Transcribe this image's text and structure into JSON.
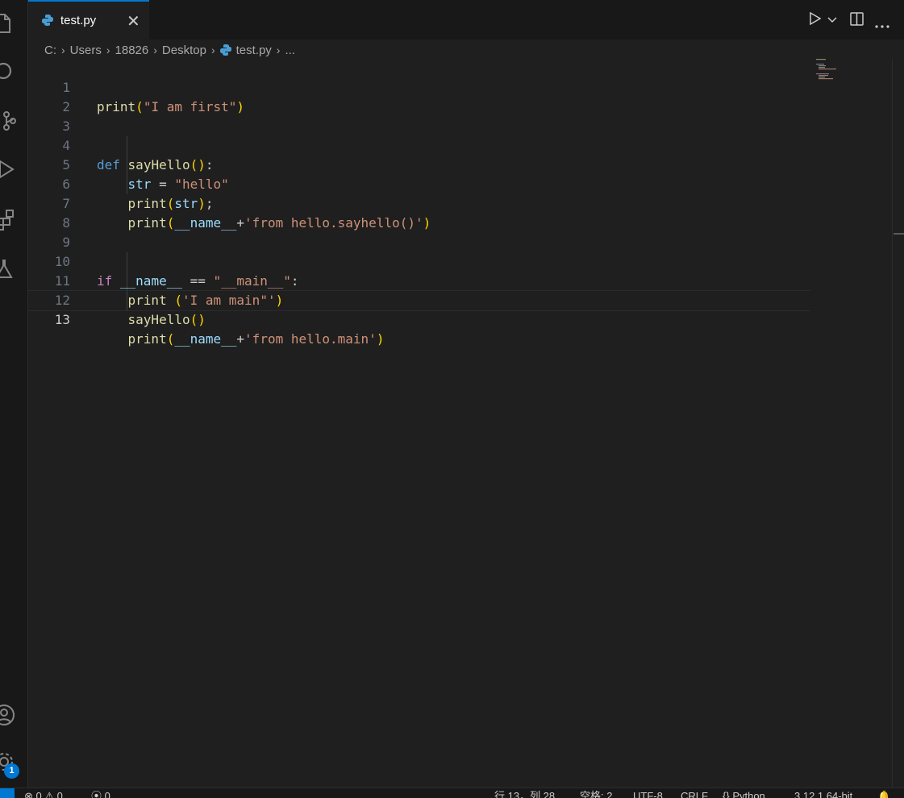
{
  "tab": {
    "label": "test.py",
    "close": "✕"
  },
  "breadcrumb": [
    "C:",
    "Users",
    "18826",
    "Desktop",
    "test.py",
    "..."
  ],
  "editor": {
    "line_numbers": [
      "1",
      "2",
      "3",
      "4",
      "5",
      "6",
      "7",
      "8",
      "9",
      "10",
      "11",
      "12",
      "13"
    ],
    "active_line": "13"
  },
  "activity_bar": {
    "icons": [
      "explorer-icon",
      "search-icon",
      "source-control-icon",
      "run-debug-icon",
      "extensions-icon",
      "testing-icon",
      "account-icon",
      "settings-icon"
    ],
    "badge": "1"
  },
  "status": {
    "errors": "0",
    "warnings": "0",
    "ports": "0",
    "position": "行 13，列 28",
    "spaces": "空格: 2",
    "encoding": "UTF-8",
    "eol": "CRLF",
    "language": "Python",
    "interpreter": "3.12.1 64-bit"
  },
  "colors": {
    "accent": "#0078d4",
    "bg": "#1f1f1f"
  }
}
